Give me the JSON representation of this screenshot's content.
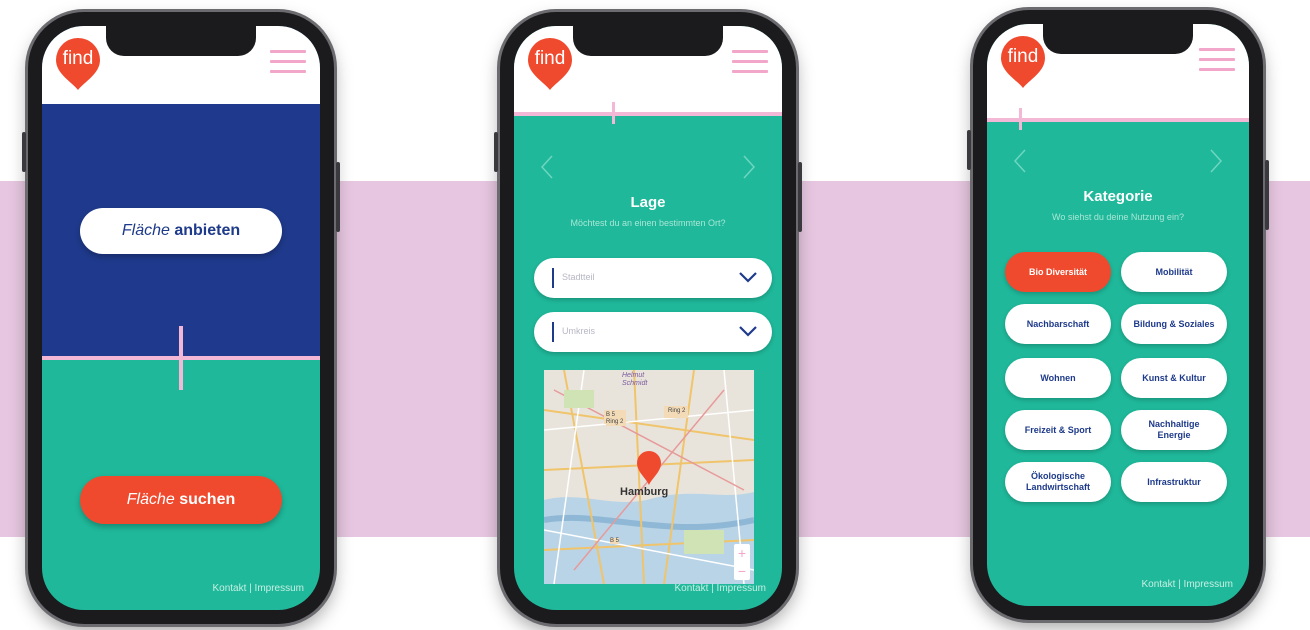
{
  "brand": {
    "logo_text": "find",
    "accent": "#f04a2e",
    "teal": "#1fb89a",
    "navy": "#1e3a8a",
    "pink": "#f2a6c9"
  },
  "phone1": {
    "offer_button": {
      "prefix": "Fläche ",
      "bold": "anbieten"
    },
    "search_button": {
      "prefix": "Fläche ",
      "bold": "suchen"
    },
    "footer": "Kontakt | Impressum"
  },
  "phone2": {
    "title": "Lage",
    "subtitle": "Möchtest du an einen bestimmten Ort?",
    "district_placeholder": "Stadtteil",
    "radius_placeholder": "Umkreis",
    "map": {
      "city": "Hamburg",
      "labels": [
        "Helmut Schmidt",
        "B 5 Ring 2",
        "Ring 2",
        "B 5"
      ]
    },
    "zoom": {
      "plus": "+",
      "minus": "−"
    },
    "footer": "Kontakt | Impressum"
  },
  "phone3": {
    "title": "Kategorie",
    "subtitle": "Wo siehst du deine Nutzung ein?",
    "categories": [
      {
        "label": "Bio Diversität",
        "active": true
      },
      {
        "label": "Mobilität",
        "active": false
      },
      {
        "label": "Nachbarschaft",
        "active": false
      },
      {
        "label": "Bildung & Soziales",
        "active": false
      },
      {
        "label": "Wohnen",
        "active": false
      },
      {
        "label": "Kunst & Kultur",
        "active": false
      },
      {
        "label": "Freizeit & Sport",
        "active": false
      },
      {
        "label": "Nachhaltige Energie",
        "active": false
      },
      {
        "label": "Ökologische Landwirtschaft",
        "active": false
      },
      {
        "label": "Infrastruktur",
        "active": false
      }
    ],
    "footer": "Kontakt | Impressum"
  }
}
